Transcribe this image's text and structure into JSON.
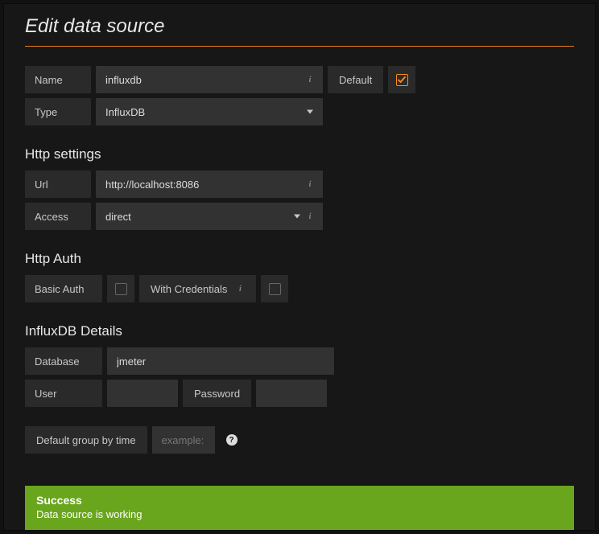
{
  "title": "Edit data source",
  "fields": {
    "name_label": "Name",
    "name_value": "influxdb",
    "default_label": "Default",
    "default_checked": true,
    "type_label": "Type",
    "type_value": "InfluxDB"
  },
  "http_settings": {
    "heading": "Http settings",
    "url_label": "Url",
    "url_value": "http://localhost:8086",
    "access_label": "Access",
    "access_value": "direct"
  },
  "http_auth": {
    "heading": "Http Auth",
    "basic_auth_label": "Basic Auth",
    "basic_auth_checked": false,
    "with_creds_label": "With Credentials",
    "with_creds_checked": false
  },
  "influxdb": {
    "heading": "InfluxDB Details",
    "database_label": "Database",
    "database_value": "jmeter",
    "user_label": "User",
    "user_value": "",
    "password_label": "Password",
    "password_value": ""
  },
  "group_by": {
    "label": "Default group by time",
    "placeholder": "example:"
  },
  "alert": {
    "title": "Success",
    "message": "Data source is working"
  }
}
